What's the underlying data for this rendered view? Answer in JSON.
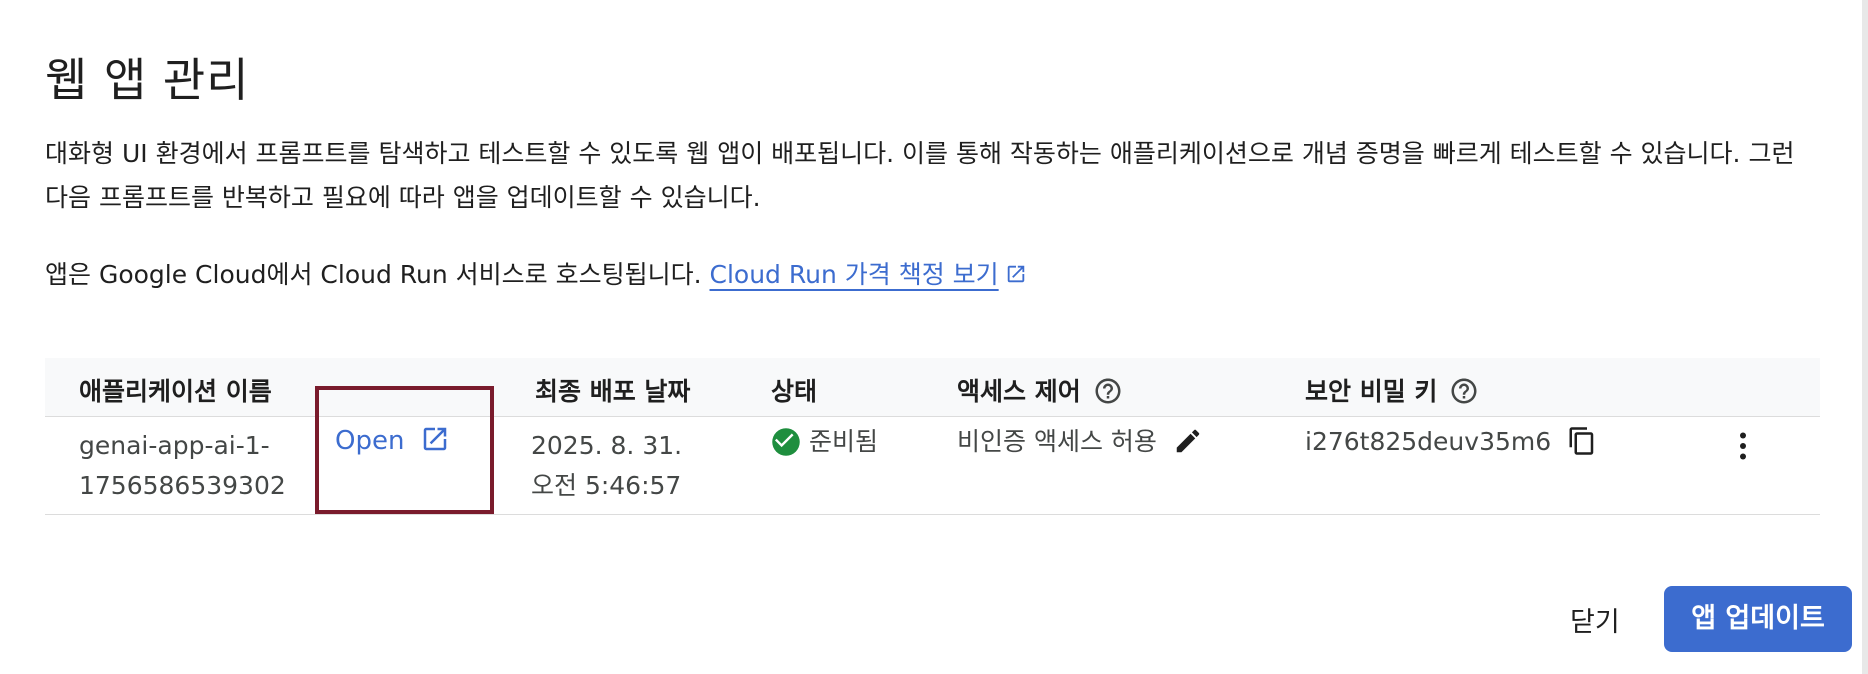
{
  "dialog": {
    "title": "웹 앱 관리",
    "description": "대화형 UI 환경에서 프롬프트를 탐색하고 테스트할 수 있도록 웹 앱이 배포됩니다. 이를 통해 작동하는 애플리케이션으로 개념 증명을 빠르게 테스트할 수 있습니다. 그런 다음 프롬프트를 반복하고 필요에 따라 앱을 업데이트할 수 있습니다.",
    "hosting_text": "앱은 Google Cloud에서 Cloud Run 서비스로 호스팅됩니다.",
    "pricing_link": "Cloud Run 가격 책정 보기"
  },
  "table": {
    "headers": {
      "app_name": "애플리케이션 이름",
      "deploy_date": "최종 배포 날짜",
      "status": "상태",
      "access": "액세스 제어",
      "secret": "보안 비밀 키"
    },
    "rows": [
      {
        "name_line1": "genai-app-ai-1-",
        "name_line2": "1756586539302",
        "open_label": "Open",
        "date_line1": "2025. 8. 31.",
        "date_line2": "오전 5:46:57",
        "status": "준비됨",
        "access": "비인증 액세스 허용",
        "secret": "i276t825deuv35m6"
      }
    ]
  },
  "footer": {
    "close_label": "닫기",
    "update_label": "앱 업데이트"
  },
  "colors": {
    "accent": "#3c6ccf",
    "status_ok": "#1e8e3e",
    "highlight_box": "#7a1b2c"
  },
  "icons": {
    "external_link": "external-link-icon",
    "help": "help-circle-icon",
    "check": "check-circle-icon",
    "edit": "pencil-icon",
    "copy": "copy-icon",
    "more": "more-vert-icon"
  }
}
